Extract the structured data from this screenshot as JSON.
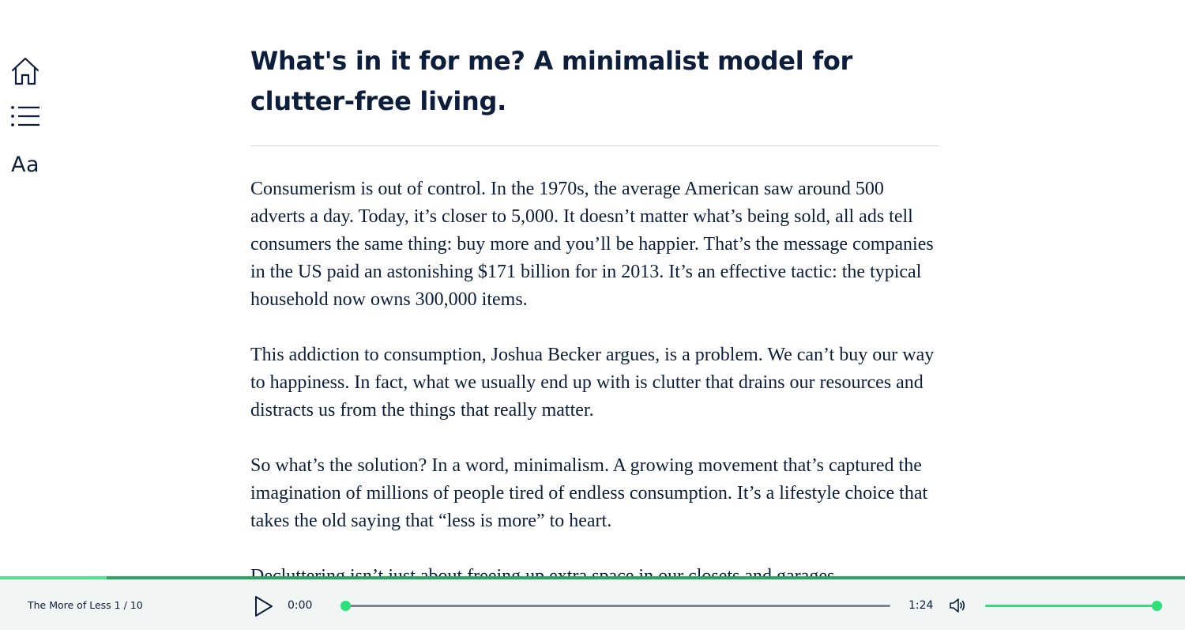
{
  "nav": {
    "home_icon": "home-icon",
    "toc_icon": "list-icon",
    "font_label": "Aa"
  },
  "chapter": {
    "title": "What's in it for me? A minimalist model for clutter-free living.",
    "paragraphs": [
      "Consumerism is out of control. In the 1970s, the average American saw around 500 adverts a day. Today, it’s closer to 5,000. It doesn’t matter what’s being sold, all ads tell consumers the same thing: buy more and you’ll be happier. That’s the message companies in the US paid an astonishing $171 billion for in 2013. It’s an effective tactic: the typical household now owns 300,000 items.",
      "This addiction to consumption, Joshua Becker argues, is a problem. We can’t buy our way to happiness. In fact, what we usually end up with is clutter that drains our resources and distracts us from the things that really matter.",
      "So what’s the solution? In a word, minimalism. A growing movement that’s captured the imagination of millions of people tired of endless consumption. It’s a lifestyle choice that takes the old saying that “less is more” to heart.",
      "Decluttering isn’t just about freeing up extra space in our closets and garages."
    ]
  },
  "player": {
    "book_info": "The More of Less 1 / 10",
    "current_time": "0:00",
    "total_time": "1:24",
    "seek_fraction": 0,
    "volume_fraction": 1,
    "chapter_progress_fraction": 0.09,
    "play_icon": "play-icon",
    "volume_icon": "speaker-icon",
    "colors": {
      "accent": "#2ee07a",
      "accent_dark": "#2ba462",
      "text": "#0c1e3b",
      "player_bg": "#f1f5f4"
    }
  }
}
